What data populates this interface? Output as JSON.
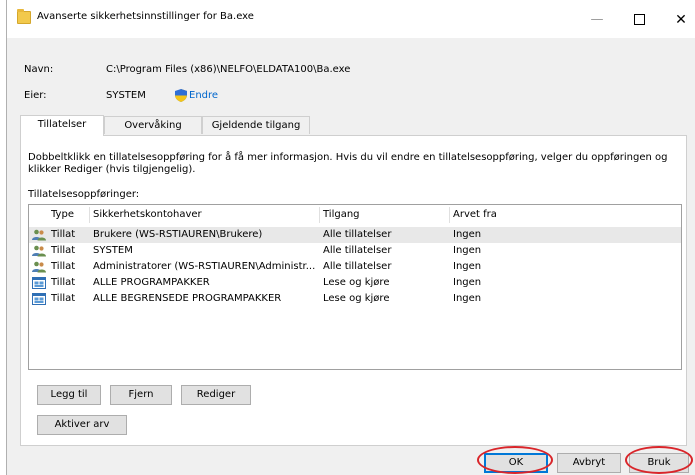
{
  "window": {
    "title": "Avanserte sikkerhetsinnstillinger for Ba.exe",
    "minimize": "—",
    "close": "✕"
  },
  "info": {
    "name_label": "Navn:",
    "name_value": "C:\\Program Files (x86)\\NELFO\\ELDATA100\\Ba.exe",
    "owner_label": "Eier:",
    "owner_value": "SYSTEM",
    "change_link": "Endre"
  },
  "tabs": [
    {
      "label": "Tillatelser",
      "active": true
    },
    {
      "label": "Overvåking",
      "active": false
    },
    {
      "label": "Gjeldende tilgang",
      "active": false
    }
  ],
  "description": "Dobbeltklikk en tillatelsesoppføring for å få mer informasjon. Hvis du vil endre en tillatelsesoppføring, velger du oppføringen og klikker Rediger (hvis tilgjengelig).",
  "entries_label": "Tillatelsesoppføringer:",
  "columns": [
    "Type",
    "Sikkerhetskontohaver",
    "Tilgang",
    "Arvet fra"
  ],
  "rows": [
    {
      "icon": "users-icon",
      "type": "Tillat",
      "principal": "Brukere (WS-RSTIAUREN\\Brukere)",
      "access": "Alle tillatelser",
      "inherited": "Ingen"
    },
    {
      "icon": "users-icon",
      "type": "Tillat",
      "principal": "SYSTEM",
      "access": "Alle tillatelser",
      "inherited": "Ingen"
    },
    {
      "icon": "users-icon",
      "type": "Tillat",
      "principal": "Administratorer (WS-RSTIAUREN\\Administr...",
      "access": "Alle tillatelser",
      "inherited": "Ingen"
    },
    {
      "icon": "package-icon",
      "type": "Tillat",
      "principal": "ALLE PROGRAMPAKKER",
      "access": "Lese og kjøre",
      "inherited": "Ingen"
    },
    {
      "icon": "package-icon",
      "type": "Tillat",
      "principal": "ALLE BEGRENSEDE PROGRAMPAKKER",
      "access": "Lese og kjøre",
      "inherited": "Ingen"
    }
  ],
  "buttons": {
    "add": "Legg til",
    "remove": "Fjern",
    "edit": "Rediger",
    "enable_inheritance": "Aktiver arv",
    "ok": "OK",
    "cancel": "Avbryt",
    "apply": "Bruk"
  },
  "colors": {
    "link": "#0066cc",
    "highlight_circle": "#d9252a",
    "default_button_border": "#0078d7"
  }
}
